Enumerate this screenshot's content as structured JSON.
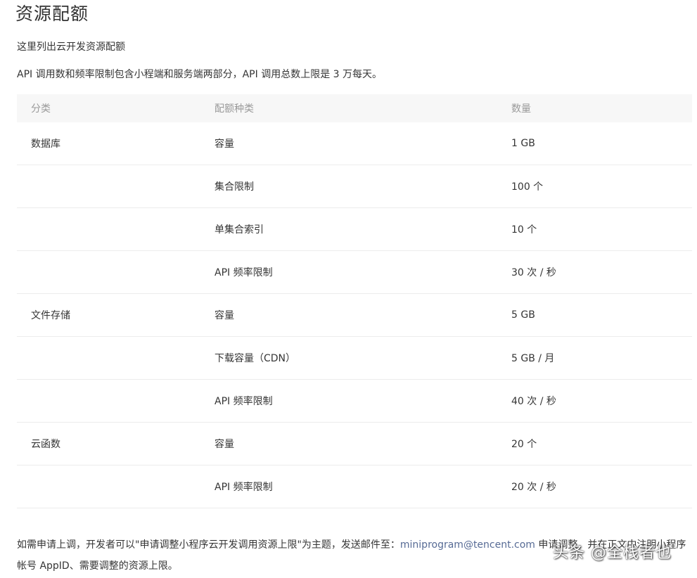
{
  "title": "资源配额",
  "intro": "这里列出云开发资源配额",
  "intro_detail": "API 调用数和频率限制包含小程端和服务端两部分，API 调用总数上限是 3 万每天。",
  "table": {
    "headers": [
      "分类",
      "配额种类",
      "数量"
    ],
    "rows": [
      {
        "category": "数据库",
        "kind": "容量",
        "amount": "1 GB"
      },
      {
        "category": "",
        "kind": "集合限制",
        "amount": "100 个"
      },
      {
        "category": "",
        "kind": "单集合索引",
        "amount": "10 个"
      },
      {
        "category": "",
        "kind": "API 频率限制",
        "amount": "30 次 / 秒"
      },
      {
        "category": "文件存储",
        "kind": "容量",
        "amount": "5 GB"
      },
      {
        "category": "",
        "kind": "下载容量（CDN）",
        "amount": "5 GB / 月"
      },
      {
        "category": "",
        "kind": "API 频率限制",
        "amount": "40 次 / 秒"
      },
      {
        "category": "云函数",
        "kind": "容量",
        "amount": "20 个"
      },
      {
        "category": "",
        "kind": "API 频率限制",
        "amount": "20 次 / 秒"
      }
    ]
  },
  "footer": {
    "text_before": "如需申请上调，开发者可以\"申请调整小程序云开发调用资源上限\"为主题，发送邮件至：",
    "email": "miniprogram@tencent.com",
    "text_after": " 申请调整，并在正文中注明小程序帐号 AppID、需要调整的资源上限。"
  },
  "watermark": "头条 @全栈者也",
  "colors": {
    "link": "#576b95",
    "header_bg": "#f7f7f7",
    "text": "#353535",
    "muted": "#9a9a9a"
  }
}
